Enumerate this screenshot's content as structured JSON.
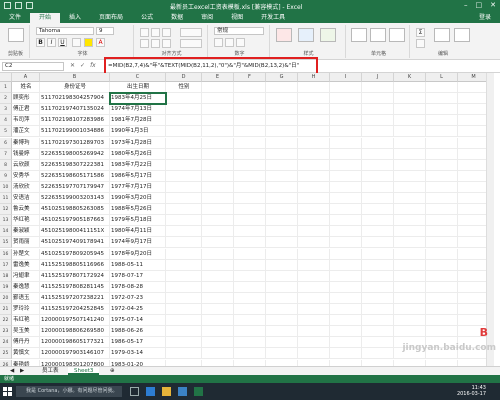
{
  "window": {
    "title": "最新员工excel工资表模板.xls [兼容模式] - Excel",
    "login": "登录"
  },
  "ribbon_tabs": [
    "文件",
    "开始",
    "插入",
    "页面布局",
    "公式",
    "数据",
    "审阅",
    "视图",
    "开发工具"
  ],
  "ribbon": {
    "font_name": "Tahoma",
    "font_size": "9",
    "number_format": "常规",
    "groups": [
      "剪贴板",
      "字体",
      "对齐方式",
      "数字",
      "样式",
      "单元格",
      "编辑"
    ],
    "buttons": [
      "条件格式",
      "套用表格格式",
      "单元格样式",
      "插入",
      "删除",
      "格式"
    ]
  },
  "formula_bar": {
    "name_box": "C2",
    "formula": "=MID(B2,7,4)&\"年\"&TEXT(MID(B2,11,2),\"0\")&\"月\"&MID(B2,13,2)&\"日\""
  },
  "columns": [
    "A",
    "B",
    "C",
    "D",
    "E",
    "F",
    "G",
    "H",
    "I",
    "J",
    "K",
    "L",
    "M",
    "N",
    "O"
  ],
  "headers": [
    "姓名",
    "身份证号",
    "出生日期",
    "性别"
  ],
  "rows": [
    [
      "顾奕彤",
      "51170219830425790​4",
      "1983年4月25日"
    ],
    [
      "傅正君",
      "51170219740713502​4",
      "1974年7月13日"
    ],
    [
      "韦司萍",
      "51170219810728398​6",
      "1981年7月28日"
    ],
    [
      "潘芷文",
      "51170219900103488​6",
      "1990年1月3日"
    ],
    [
      "秦博玙",
      "51170219730128970​3",
      "1973年1月28日"
    ],
    [
      "钱曼婷",
      "52263519800526994​2",
      "1980年5月26日"
    ],
    [
      "云欣颜",
      "52263519830722238​1",
      "1983年7月22日"
    ],
    [
      "安秀华",
      "52263519860517158​6",
      "1986年5月17日"
    ],
    [
      "汤欣欣",
      "52263519770717994​7",
      "1977年7月17日"
    ],
    [
      "安语洁",
      "52263519900320314​3",
      "1990年3月20日"
    ],
    [
      "鲁云美",
      "45102519880526308​5",
      "1988年5月26日"
    ],
    [
      "华红艳",
      "45102519790518766​3",
      "1979年5月18日"
    ],
    [
      "秦淑颖",
      "45102519800411151X",
      "1980年4月11日"
    ],
    [
      "贺雨丽",
      "45102519740917894​1",
      "1974年9月17日"
    ],
    [
      "孙楚文",
      "45102519780920594​5",
      "1978年9月20日"
    ],
    [
      "雷逸美",
      "41152519880511696​6",
      "1988-05-11"
    ],
    [
      "冯翅聿",
      "41152519780717292​4",
      "1978-07-17"
    ],
    [
      "秦逸慧",
      "41152519780828114​5",
      "1978-08-28"
    ],
    [
      "鄞语玉",
      "41152519720723822​1",
      "1972-07-23"
    ],
    [
      "罗玲玲",
      "41152519720425284​5",
      "1972-04-25"
    ],
    [
      "韦红艳",
      "12000019750714124​0",
      "1975-07-14"
    ],
    [
      "吴玉美",
      "12000019880626958​0",
      "1988-06-26"
    ],
    [
      "傅丹丹",
      "12000019860517732​1",
      "1986-05-17"
    ],
    [
      "黄慎文",
      "12000019790314610​7",
      "1979-03-14"
    ],
    [
      "秦艳娇",
      "12000019830120780​0",
      "1983-01-20"
    ]
  ],
  "sheets": [
    "员工表",
    "Sheet3"
  ],
  "status": "就绪",
  "taskbar": {
    "search_placeholder": "我是 Cortana，小娜。有问题尽管问我。",
    "time": "11:43",
    "date": "2016-03-17"
  },
  "watermark": "jingyan.baidu.com"
}
